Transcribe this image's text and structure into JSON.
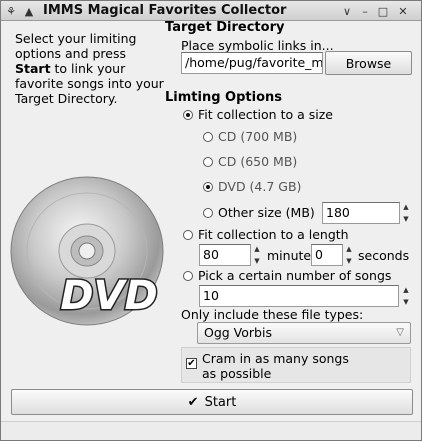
{
  "window": {
    "title": "IMMS Magical Favorites Collector",
    "icons": [
      "pin-icon",
      "menu-icon",
      "shade-icon",
      "minimize-icon",
      "maximize-icon",
      "close-icon"
    ]
  },
  "intro": {
    "line1": "Select your limiting options and press ",
    "bold": "Start",
    "line2": " to link your favorite songs into your Target Directory."
  },
  "target": {
    "title": "Target Directory",
    "subtitle": "Place symbolic links in...",
    "path_value": "/home/pug/favorite_m",
    "browse_label": "Browse"
  },
  "limiting": {
    "title": "Limting Options",
    "fit_size_label": "Fit collection to a size",
    "size_options": [
      {
        "label": "CD (700 MB)",
        "selected": false
      },
      {
        "label": "CD (650 MB)",
        "selected": false
      },
      {
        "label": "DVD (4.7 GB)",
        "selected": true
      },
      {
        "label": "Other size (MB)",
        "selected": false
      }
    ],
    "other_size_value": "180",
    "fit_length_label": "Fit collection to a length",
    "minutes_value": "80",
    "minutes_label": "minutes",
    "seconds_value": "0",
    "seconds_label": "seconds",
    "number_label": "Pick a certain number of songs",
    "number_value": "10",
    "filetypes_label": "Only include these file types:",
    "filetype_selected": "Ogg Vorbis",
    "cram_label_line1": "Cram in as many songs",
    "cram_label_line2": "as possible",
    "cram_checked": true
  },
  "start_label": "Start",
  "disc": {
    "logo_text": "DVD"
  }
}
